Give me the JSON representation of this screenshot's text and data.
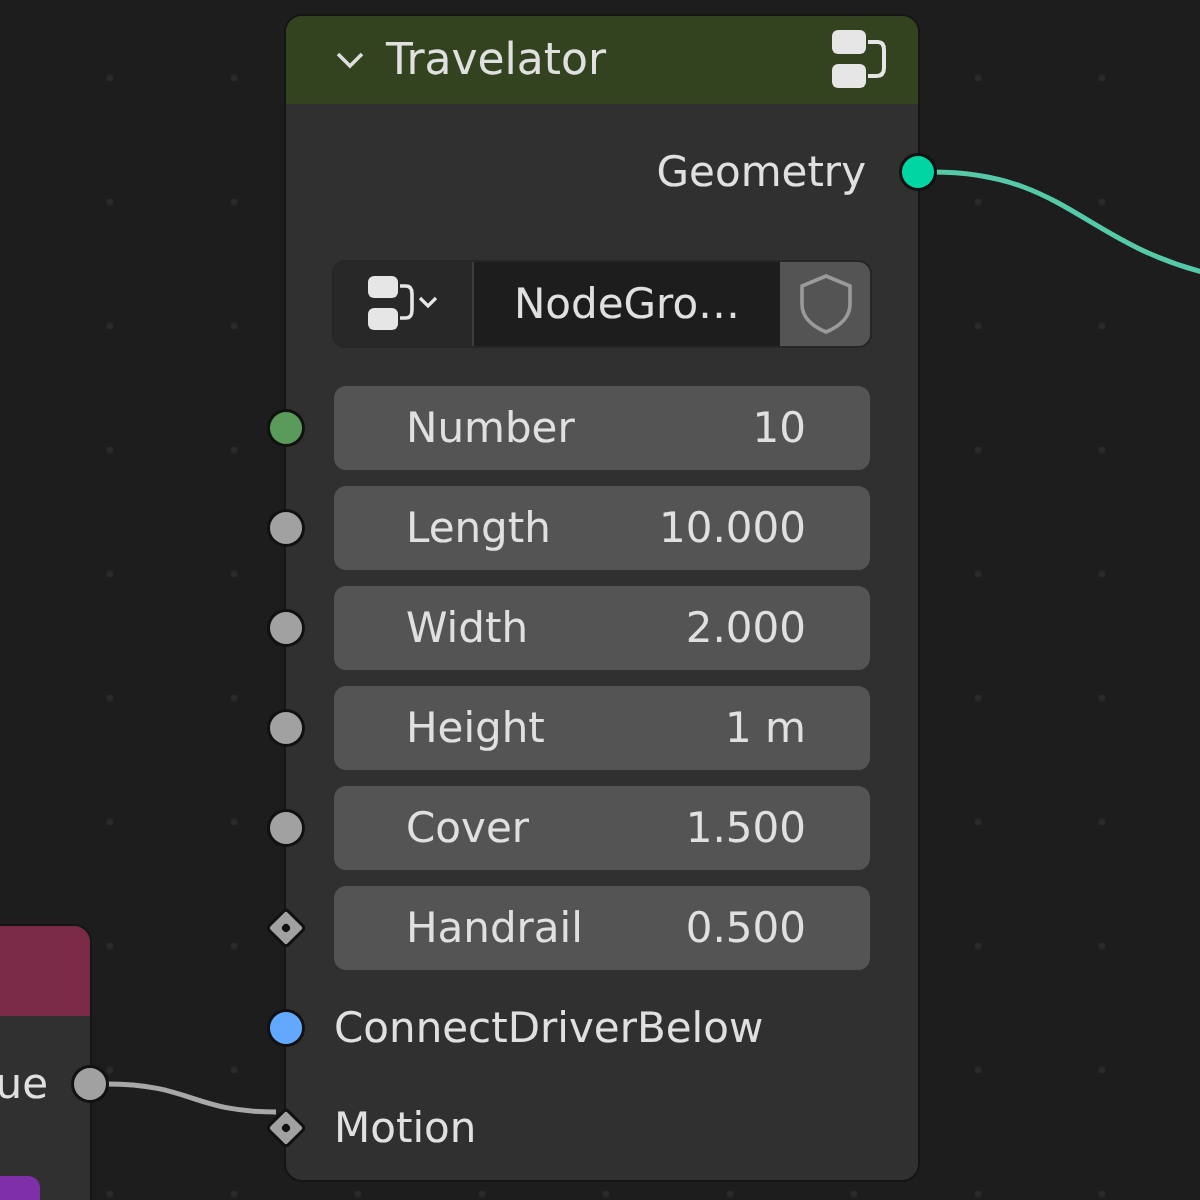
{
  "node": {
    "title": "Travelator",
    "expanded": true,
    "outputs": [
      {
        "label": "Geometry",
        "socket": {
          "kind": "circle",
          "color": "#00d6a3"
        }
      }
    ],
    "group_selector": {
      "name": "NodeGro…"
    },
    "inputs": [
      {
        "kind": "field",
        "label": "Number",
        "value": "10",
        "socket": {
          "kind": "circle",
          "color": "#5a9a5a"
        }
      },
      {
        "kind": "field",
        "label": "Length",
        "value": "10.000",
        "socket": {
          "kind": "circle",
          "color": "#a1a1a1"
        }
      },
      {
        "kind": "field",
        "label": "Width",
        "value": "2.000",
        "socket": {
          "kind": "circle",
          "color": "#a1a1a1"
        }
      },
      {
        "kind": "field",
        "label": "Height",
        "value": "1 m",
        "socket": {
          "kind": "circle",
          "color": "#a1a1a1"
        }
      },
      {
        "kind": "field",
        "label": "Cover",
        "value": "1.500",
        "socket": {
          "kind": "circle",
          "color": "#a1a1a1"
        }
      },
      {
        "kind": "field",
        "label": "Handrail",
        "value": "0.500",
        "socket": {
          "kind": "diamond",
          "color": "#a1a1a1"
        }
      },
      {
        "kind": "plain",
        "label": "ConnectDriverBelow",
        "socket": {
          "kind": "circle",
          "color": "#63a8ff"
        }
      },
      {
        "kind": "plain",
        "label": "Motion",
        "socket": {
          "kind": "diamond",
          "color": "#a1a1a1"
        }
      }
    ]
  },
  "left_node": {
    "output": {
      "label": "ue",
      "socket": {
        "kind": "circle",
        "color": "#a1a1a1"
      }
    }
  }
}
